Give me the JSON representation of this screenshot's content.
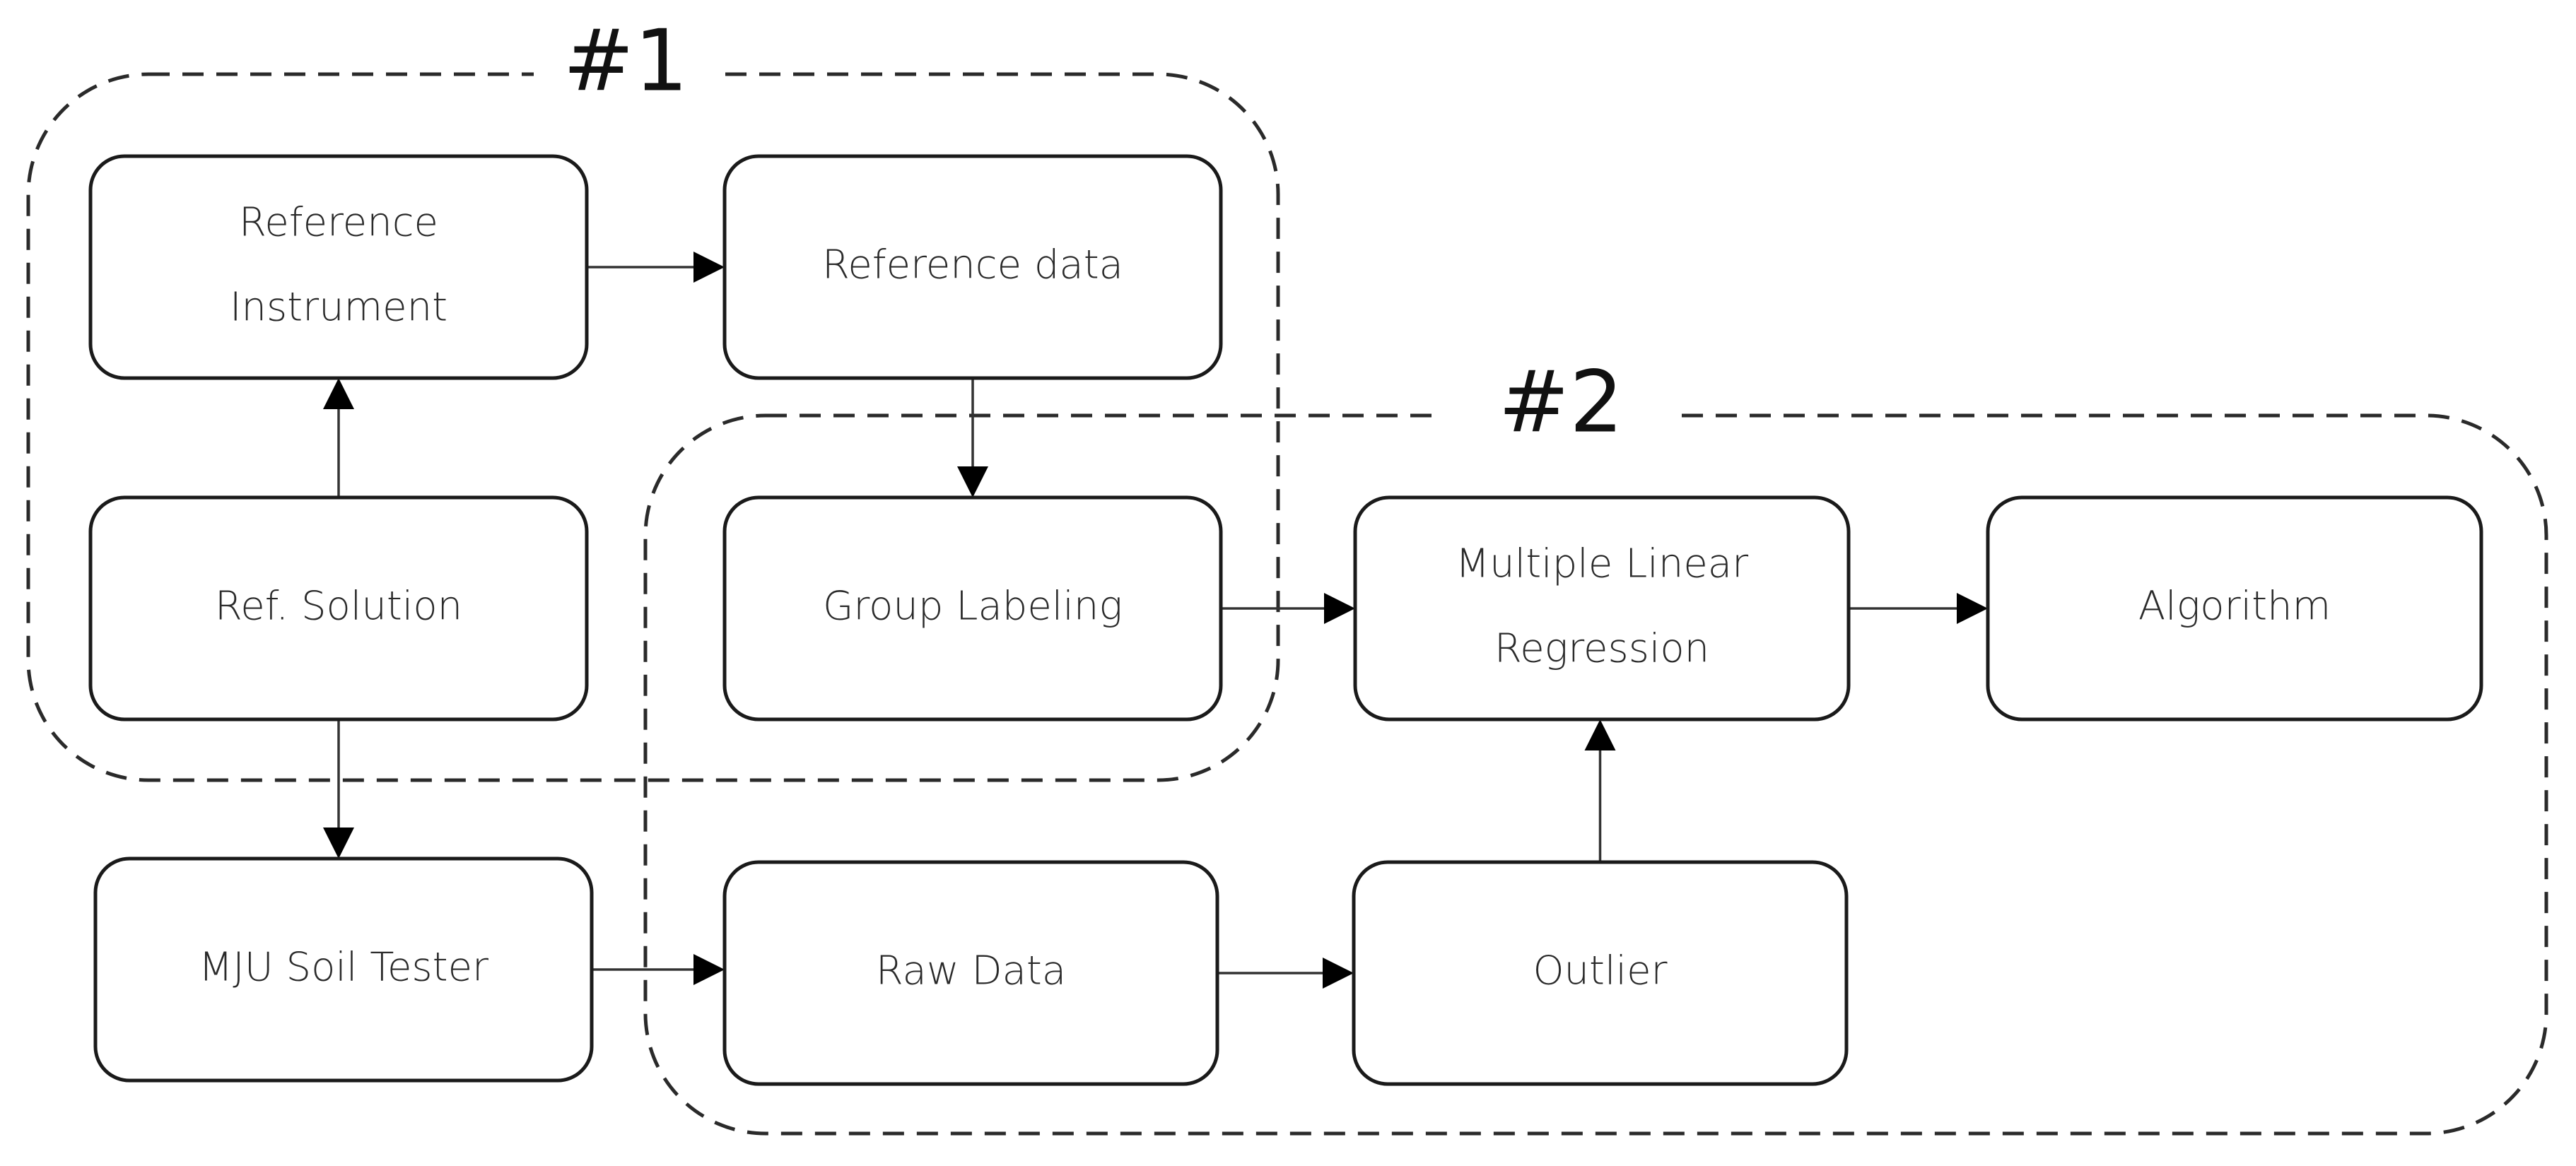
{
  "diagram": {
    "type": "flowchart",
    "groups": [
      {
        "id": "g1",
        "label": "#1",
        "members": [
          "ref_instrument",
          "ref_data",
          "ref_solution",
          "group_labeling"
        ]
      },
      {
        "id": "g2",
        "label": "#2",
        "members": [
          "group_labeling",
          "mlr",
          "algorithm",
          "raw_data",
          "outlier"
        ]
      }
    ],
    "nodes": [
      {
        "id": "ref_instrument",
        "lines": [
          "Reference",
          "Instrument"
        ]
      },
      {
        "id": "ref_data",
        "lines": [
          "Reference data"
        ]
      },
      {
        "id": "ref_solution",
        "lines": [
          "Ref. Solution"
        ]
      },
      {
        "id": "group_labeling",
        "lines": [
          "Group Labeling"
        ]
      },
      {
        "id": "mlr",
        "lines": [
          "Multiple Linear",
          "Regression"
        ]
      },
      {
        "id": "algorithm",
        "lines": [
          "Algorithm"
        ]
      },
      {
        "id": "mju_soil_tester",
        "lines": [
          "MJU Soil Tester"
        ]
      },
      {
        "id": "raw_data",
        "lines": [
          "Raw Data"
        ]
      },
      {
        "id": "outlier",
        "lines": [
          "Outlier"
        ]
      }
    ],
    "edges": [
      {
        "from": "ref_solution",
        "to": "ref_instrument"
      },
      {
        "from": "ref_instrument",
        "to": "ref_data"
      },
      {
        "from": "ref_data",
        "to": "group_labeling"
      },
      {
        "from": "group_labeling",
        "to": "mlr"
      },
      {
        "from": "mlr",
        "to": "algorithm"
      },
      {
        "from": "ref_solution",
        "to": "mju_soil_tester"
      },
      {
        "from": "mju_soil_tester",
        "to": "raw_data"
      },
      {
        "from": "raw_data",
        "to": "outlier"
      },
      {
        "from": "outlier",
        "to": "mlr"
      }
    ]
  }
}
